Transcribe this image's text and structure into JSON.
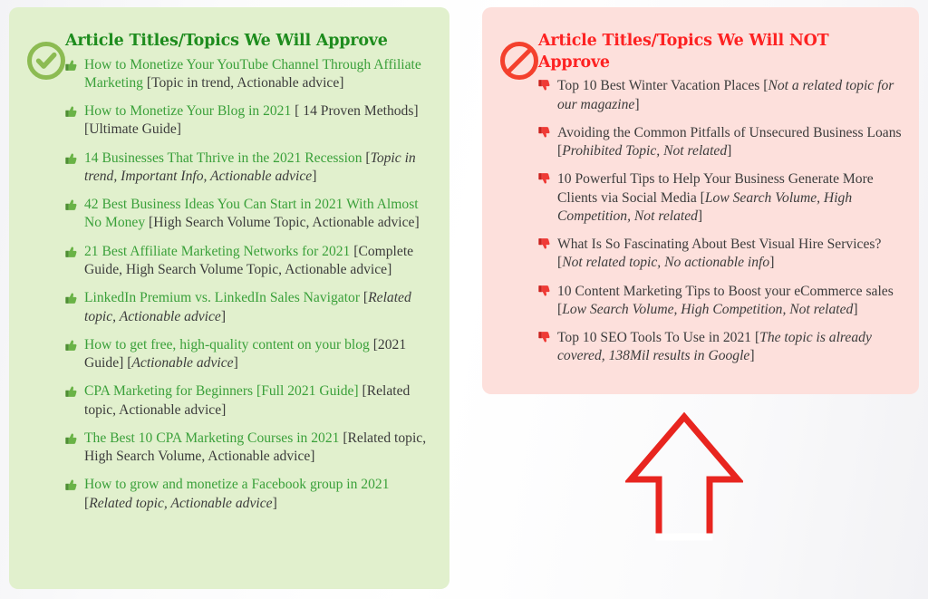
{
  "colors": {
    "approve_panel_bg": "#e1f0cd",
    "reject_panel_bg": "#fde0dc",
    "approve_title": "#1e8c1e",
    "reject_title": "#fd2222",
    "approve_item_title": "#3aa03a",
    "note_text": "#3c3c3c",
    "check_icon": "#8cbb52",
    "ban_icon": "#f4402d",
    "arrow_outline": "#e8251f",
    "page_bg": "#ffffff"
  },
  "approve": {
    "icon": "circle-check-icon",
    "title": "Article Titles/Topics We Will Approve",
    "items": [
      {
        "bullet": "thumbs-up-icon",
        "title": "How to Monetize Your YouTube Channel Through Affiliate Marketing",
        "note_open": " [",
        "note_italic": "",
        "note_plain": "Topic in trend, Actionable advice",
        "note_close": "]"
      },
      {
        "bullet": "thumbs-up-icon",
        "title": "How to Monetize Your Blog in 2021",
        "note_open": " [ ",
        "note_italic": "",
        "note_plain": "14 Proven Methods] [Ultimate Guide",
        "note_close": "]"
      },
      {
        "bullet": "thumbs-up-icon",
        "title": "14 Businesses That Thrive in the 2021 Recession",
        "note_open": " [",
        "note_italic": "Topic in trend, Important Info, Actionable advice",
        "note_plain": "",
        "note_close": "]"
      },
      {
        "bullet": "thumbs-up-icon",
        "title": "42 Best Business Ideas You Can Start in 2021 With Almost No Money",
        "note_open": " [",
        "note_italic": "",
        "note_plain": "High Search Volume Topic, Actionable advice",
        "note_close": "]"
      },
      {
        "bullet": "thumbs-up-icon",
        "title": "21 Best Affiliate Marketing Networks for 2021",
        "note_open": " [",
        "note_italic": "",
        "note_plain": "Complete Guide, High Search Volume Topic, Actionable advice",
        "note_close": "]"
      },
      {
        "bullet": "thumbs-up-icon",
        "title": "LinkedIn Premium vs. LinkedIn Sales Navigator",
        "note_open": " [",
        "note_italic": "Related topic, Actionable advice",
        "note_plain": "",
        "note_close": "]"
      },
      {
        "bullet": "thumbs-up-icon",
        "title": "How to get free, high-quality content on your blog",
        "note_open": " [2021 Guide] [",
        "note_italic": "Actionable advice",
        "note_plain": "",
        "note_close": "]"
      },
      {
        "bullet": "thumbs-up-icon",
        "title": "CPA Marketing for Beginners [Full 2021 Guide]",
        "note_open": " [",
        "note_italic": "",
        "note_plain": "Related topic, Actionable advice",
        "note_close": "]"
      },
      {
        "bullet": "thumbs-up-icon",
        "title": "The Best 10 CPA Marketing Courses in 2021",
        "note_open": " [",
        "note_italic": "",
        "note_plain": "Related topic, High Search Volume, Actionable advice",
        "note_close": "]"
      },
      {
        "bullet": "thumbs-up-icon",
        "title": "How to grow and monetize a Facebook group in 2021",
        "note_open": " [",
        "note_italic": "Related topic, Actionable advice",
        "note_plain": "",
        "note_close": "]"
      }
    ]
  },
  "reject": {
    "icon": "no-entry-icon",
    "title": "Article Titles/Topics We Will NOT Approve",
    "items": [
      {
        "bullet": "thumbs-down-icon",
        "title": "Top 10 Best Winter Vacation Places",
        "note_open": " [",
        "note_italic": "Not a related topic for our magazine",
        "note_plain": "",
        "note_close": "]"
      },
      {
        "bullet": "thumbs-down-icon",
        "title": "Avoiding the Common Pitfalls of Unsecured Business Loans",
        "note_open": " [",
        "note_italic": "Prohibited Topic, Not related",
        "note_plain": "",
        "note_close": "]"
      },
      {
        "bullet": "thumbs-down-icon",
        "title": "10 Powerful Tips to Help Your Business Generate More Clients via Social Media",
        "note_open": " [",
        "note_italic": "Low Search Volume, High Competition, Not related",
        "note_plain": "",
        "note_close": "]"
      },
      {
        "bullet": "thumbs-down-icon",
        "title": "What Is So Fascinating About Best Visual Hire Services?",
        "note_open": " [",
        "note_italic": "Not related topic, No actionable info",
        "note_plain": "",
        "note_close": "]"
      },
      {
        "bullet": "thumbs-down-icon",
        "title": "10 Content Marketing Tips to Boost your eCommerce sales",
        "note_open": " [",
        "note_italic": "Low Search Volume, High Competition, Not related",
        "note_plain": "",
        "note_close": "]"
      },
      {
        "bullet": "thumbs-down-icon",
        "title": "Top 10 SEO Tools To Use in 2021",
        "note_open": " [",
        "note_italic": "The topic is already covered, 138Mil results in Google",
        "note_plain": "",
        "note_close": "]"
      }
    ]
  },
  "arrow": {
    "name": "up-arrow-outline",
    "direction": "up",
    "color": "#e8251f"
  }
}
